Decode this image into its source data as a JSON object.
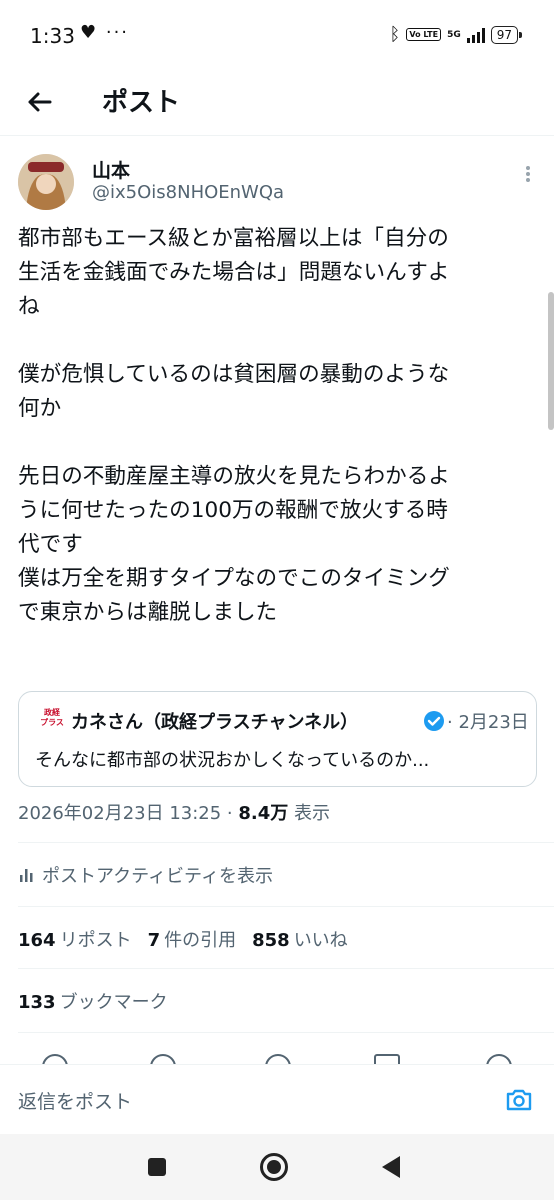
{
  "status_bar": {
    "time": "1:33",
    "left_icons": "♥ ···",
    "volte": "Vo LTE",
    "signal": "5G",
    "battery": "97"
  },
  "header": {
    "title": "ポスト"
  },
  "post": {
    "author_name": "山本",
    "author_handle": "@ix5Ois8NHOEnWQa",
    "body": [
      [
        "都市部もエース級とか富裕層以上は「自分の",
        "生活を金銭面でみた場合は」問題ないんすよ",
        "ね"
      ],
      [
        "僕が危惧しているのは貧困層の暴動のような",
        "何か"
      ],
      [
        "先日の不動産屋主導の放火を見たらわかるよ",
        "うに何せたったの100万の報酬で放火する時",
        "代です",
        "僕は万全を期すタイプなのでこのタイミング",
        "で東京からは離脱しました"
      ]
    ],
    "quote": {
      "logo_text": "政経\nプラス",
      "name": "カネさん（政経プラスチャンネル）",
      "date": "· 2月23日",
      "text": "そんなに都市部の状況おかしくなっているのか..."
    },
    "timestamp": "2026年02月23日 13:25 · ",
    "views_count": "8.4万",
    "views_label": " 表示",
    "activity_label": "ポストアクティビティを表示",
    "stats": {
      "reposts_count": "164",
      "reposts_label": "リポスト",
      "quotes_count": "7",
      "quotes_label": "件の引用",
      "likes_count": "858",
      "likes_label": "いいね",
      "bookmarks_count": "133",
      "bookmarks_label": "ブックマーク"
    }
  },
  "reply_bar": {
    "placeholder": "返信をポスト"
  },
  "colors": {
    "text": "#0f1419",
    "secondary": "#536471",
    "accent": "#1d9bf0",
    "quote_logo": "#c8102e"
  },
  "icons": [
    "back-arrow-icon",
    "more-icon",
    "verified-icon",
    "bar-chart-icon",
    "camera-icon",
    "reply-icon",
    "repost-icon",
    "like-icon",
    "bookmark-icon",
    "share-icon"
  ]
}
